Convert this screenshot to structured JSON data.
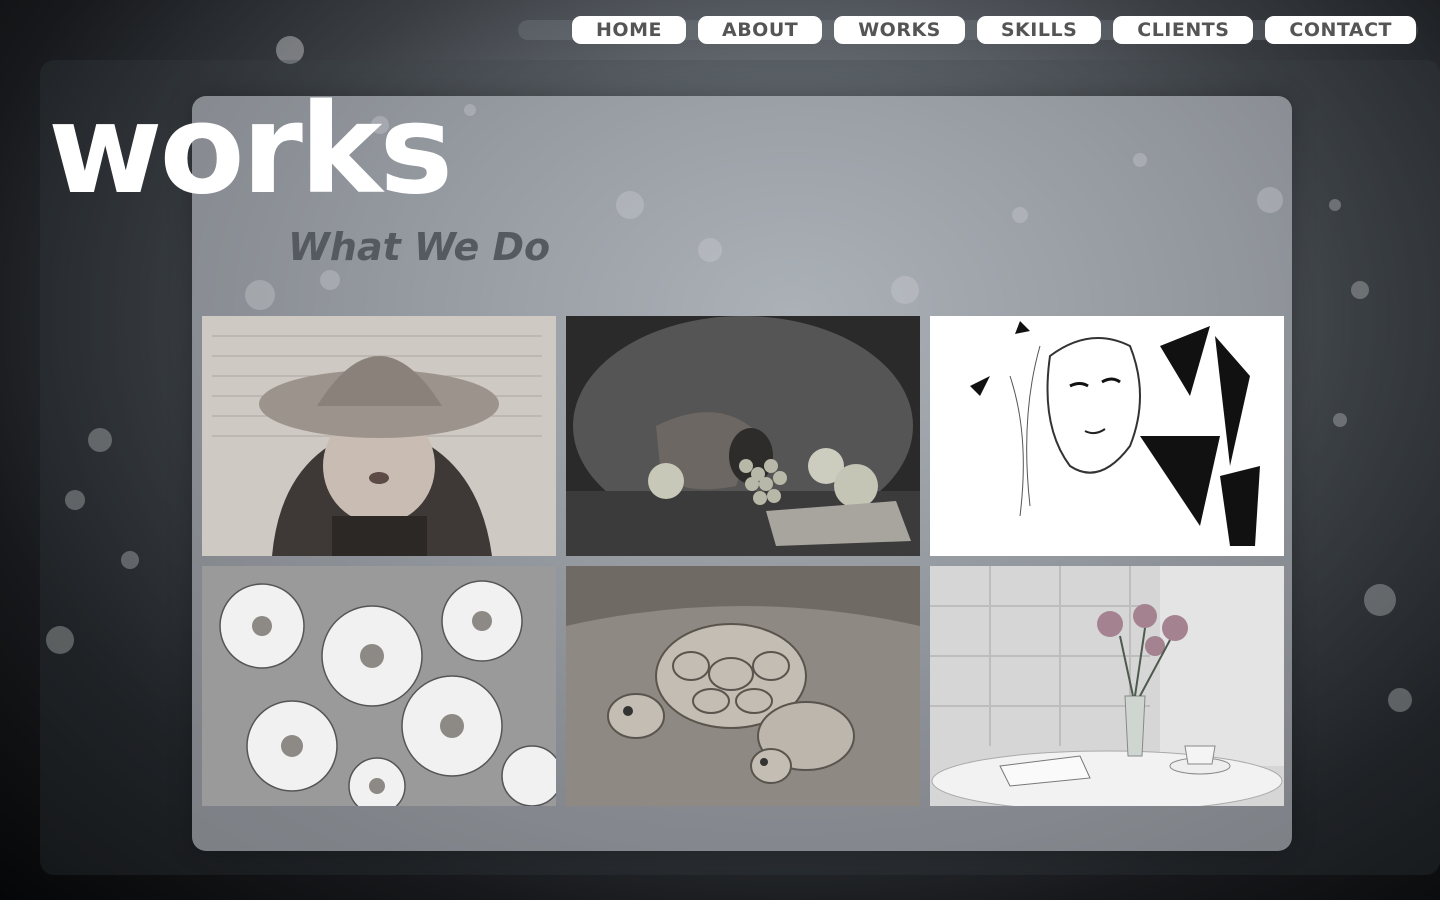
{
  "nav": {
    "items": [
      {
        "label": "HOME"
      },
      {
        "label": "ABOUT"
      },
      {
        "label": "WORKS"
      },
      {
        "label": "SKILLS"
      },
      {
        "label": "CLIENTS"
      },
      {
        "label": "CONTACT"
      }
    ]
  },
  "section": {
    "title": "works",
    "subtitle": "What We Do"
  },
  "gallery": {
    "items": [
      {
        "icon": "woman-in-hat-image"
      },
      {
        "icon": "still-life-fruit-image"
      },
      {
        "icon": "sketch-face-image"
      },
      {
        "icon": "flowers-painting-image"
      },
      {
        "icon": "sand-turtles-image"
      },
      {
        "icon": "roses-vase-image"
      }
    ]
  },
  "colors": {
    "nav_bg": "#ffffff",
    "nav_text": "#555555",
    "title": "#ffffff",
    "subtitle": "#555a60"
  }
}
